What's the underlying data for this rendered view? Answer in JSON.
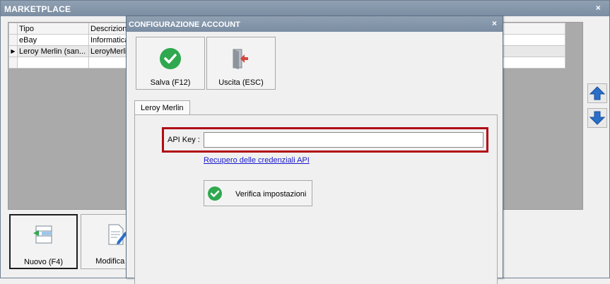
{
  "main": {
    "title": "MARKETPLACE",
    "close_glyph": "×",
    "grid": {
      "columns": [
        "Tipo",
        "Descrizione"
      ],
      "rows": [
        {
          "tipo": "eBay",
          "descrizione": "Informatica"
        },
        {
          "tipo": "Leroy Merlin (san...",
          "descrizione": "LeroyMerlin"
        },
        {
          "tipo": "",
          "descrizione": ""
        }
      ],
      "current_row_marker": "▶"
    },
    "side_buttons": {
      "up_icon": "arrow-up-icon",
      "down_icon": "arrow-down-icon"
    },
    "bottom_buttons": [
      {
        "label": "Nuovo (F4)",
        "icon": "new-record-icon"
      },
      {
        "label": "Modifica (F",
        "icon": "edit-document-icon"
      }
    ]
  },
  "dialog": {
    "title": "CONFIGURAZIONE ACCOUNT",
    "close_glyph": "×",
    "toolbar": {
      "save_label": "Salva (F12)",
      "exit_label": "Uscita (ESC)"
    },
    "tab_label": "Leroy Merlin",
    "api_key": {
      "label": "API Key :",
      "value": ""
    },
    "credentials_link": "Recupero delle credenziali API",
    "verify_label": "Verifica impostazioni"
  },
  "colors": {
    "title_bar": "#7b8da2",
    "accent_green": "#2fa84f",
    "highlight_red": "#b00b16",
    "arrow_blue": "#2a6fc9",
    "link_blue": "#1a1acc"
  }
}
